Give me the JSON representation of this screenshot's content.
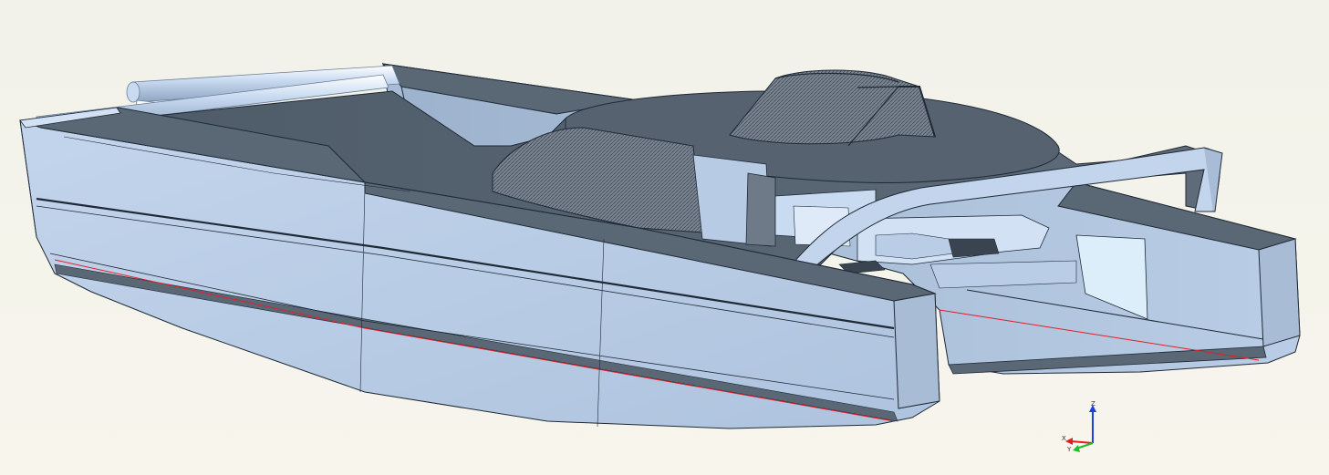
{
  "viewport": {
    "background_top": "#f2f2ea",
    "background_bottom": "#f7f5ec"
  },
  "model": {
    "hull_color": "#b9cde6",
    "hull_shade": "#a4b8d1",
    "deck_color": "#5a6775",
    "edge_color": "#1f2a36",
    "waterline_color": "#e0202a"
  },
  "triad": {
    "x_label": "X",
    "y_label": "Y",
    "z_label": "Z",
    "x_color": "#e01f1f",
    "y_color": "#1fbf2a",
    "z_color": "#1f3fe0"
  }
}
